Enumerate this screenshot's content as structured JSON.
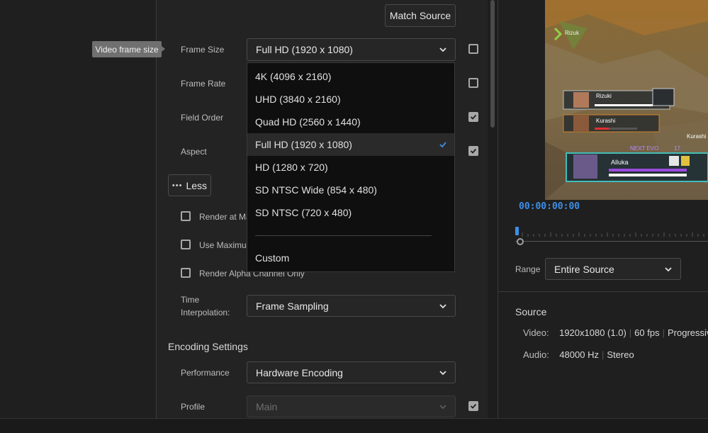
{
  "colors": {
    "accent": "#3d8ee6",
    "panel": "#232323",
    "dropdown_bg": "#0f0f0f",
    "tooltip_bg": "#707070"
  },
  "tooltip": "Video frame size",
  "match_source_label": "Match Source",
  "fields": {
    "frame_size_label": "Frame Size",
    "frame_size_value": "Full HD (1920 x 1080)",
    "frame_rate_label": "Frame Rate",
    "field_order_label": "Field Order",
    "aspect_label": "Aspect"
  },
  "less_button": "Less",
  "less_icon": "more-dots-icon",
  "checkboxes": {
    "render_max": "Render at Max",
    "use_max": "Use Maximum",
    "render_alpha": "Render Alpha Channel Only"
  },
  "time_interp": {
    "label_line1": "Time",
    "label_line2": "Interpolation:",
    "value": "Frame Sampling"
  },
  "encoding": {
    "title": "Encoding Settings",
    "performance_label": "Performance",
    "performance_value": "Hardware Encoding",
    "profile_label": "Profile",
    "profile_value": "Main"
  },
  "dropdown": {
    "items": [
      "4K (4096 x 2160)",
      "UHD (3840 x 2160)",
      "Quad HD (2560 x 1440)",
      "Full HD (1920 x 1080)",
      "HD (1280 x 720)",
      "SD NTSC Wide (854 x 480)",
      "SD NTSC (720 x 480)"
    ],
    "custom": "Custom",
    "selected_index": 3,
    "check_icon": "checkmark-icon"
  },
  "preview": {
    "timecode": "00:00:00:00",
    "hud": {
      "player1": "Rizuki",
      "player2": "Kurashi",
      "player3": "Kurashi",
      "player4": "Alluka",
      "top_name": "Rizuk",
      "evo": "NEXT EVO",
      "evo_num": "17"
    }
  },
  "range": {
    "label": "Range",
    "value": "Entire Source"
  },
  "source": {
    "title": "Source",
    "video_label": "Video:",
    "video_res": "1920x1080 (1.0)",
    "video_fps": "60 fps",
    "video_scan": "Progressive",
    "audio_label": "Audio:",
    "audio_rate": "48000 Hz",
    "audio_ch": "Stereo"
  }
}
